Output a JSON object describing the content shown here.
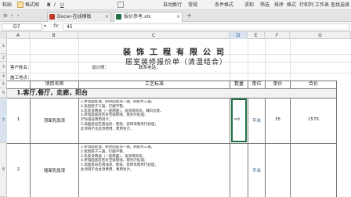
{
  "ribbon": {
    "items": [
      {
        "label": "粘贴"
      },
      {
        "label": "格式刷"
      },
      {
        "label": "自动换行"
      },
      {
        "label": "常规"
      },
      {
        "label": "条件格式"
      },
      {
        "label": "求和"
      },
      {
        "label": "筛选"
      },
      {
        "label": "排序"
      },
      {
        "label": "格式"
      },
      {
        "label": "行和列"
      },
      {
        "label": "工作表"
      },
      {
        "label": "查找选择"
      }
    ]
  },
  "tabs": [
    {
      "label": "Docer-在线模板",
      "active": false
    },
    {
      "label": "报价参考.xls",
      "active": true
    }
  ],
  "formula_bar": {
    "cell_ref": "D7",
    "fx": "fx",
    "value": "45"
  },
  "columns": [
    "A",
    "B",
    "C",
    "D",
    "E",
    "F",
    "G"
  ],
  "selected_column": "D",
  "rows": [
    "1",
    "2",
    "3",
    "4",
    "5",
    "6",
    "7",
    "8"
  ],
  "selected_row": "7",
  "sheet": {
    "company": "装饰工程有限公司",
    "title": "居室装修报价单（清湿结合）",
    "customer_label": "客户姓名：",
    "designer_label": "设计师：",
    "phone_label": "联系电话：",
    "address_label": "施工地点：",
    "headers": {
      "item": "项目名称",
      "process": "工艺标准",
      "qty": "数量",
      "unit": "单位",
      "price": "单价",
      "total": "合价"
    },
    "section": "1.客厅,餐厅，走廊，阳台",
    "items": [
      {
        "no": "1",
        "name": "顶面乳胶漆",
        "notes": [
          "1.原墙面处理，刷封固底漆一遍，刷胶水三遍。",
          "2.批刮腻子三遍，打磨平整。",
          "3.乳胶漆两遍（一底两面），滚涂或喷涂，辅料含量。",
          "4.原墙面基层若有空鼓裂缝，需另外处理；",
          "  铲除基层费用另计。",
          "5.墙面基层若遇油漆、壁纸、瓷砖等需另行处理，",
          "  此项目不含此项费用，费用另计。"
        ],
        "unit": "平米",
        "price": "35",
        "total": "1575"
      },
      {
        "no": "2",
        "name": "墙面乳胶漆",
        "notes": [
          "1.原墙面处理，刷封固底漆一遍，刷胶水三遍。",
          "2.批刮腻子三遍，打磨平整。",
          "3.乳胶漆两遍（一底两面），滚涂或喷涂。",
          "4.原墙面基层若有空鼓裂缝，需另外处理；",
          "5.墙面基层若遇油漆、壁纸、瓷砖等需另行处理，",
          "  此项目不含此项费用，费用另计。"
        ],
        "unit": "平米",
        "price": "",
        "total": ""
      }
    ]
  },
  "colors": {
    "accent": "#217346",
    "selection": "#d9e3f0",
    "section_bg": "#f2f2f2"
  }
}
